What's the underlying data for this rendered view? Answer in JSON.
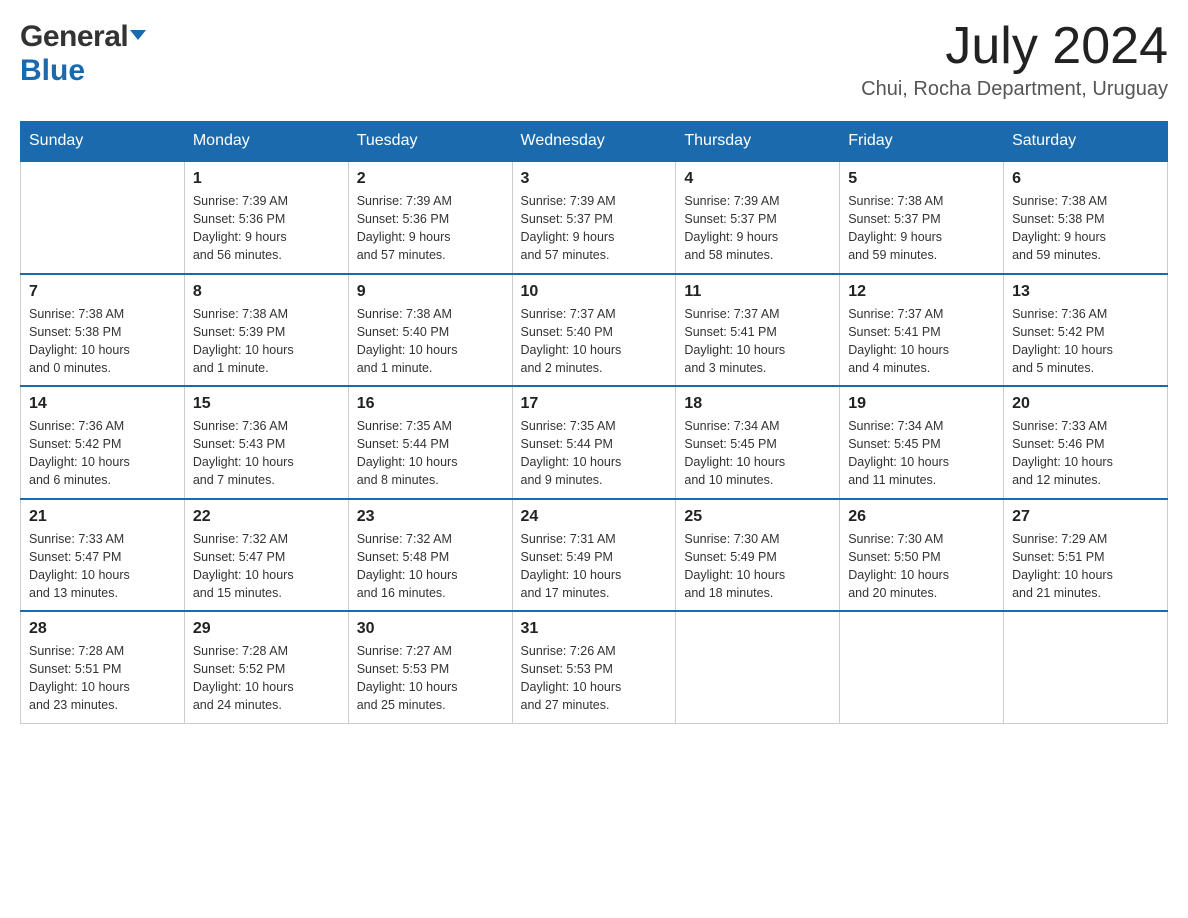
{
  "header": {
    "logo_general": "General",
    "logo_blue": "Blue",
    "month_year": "July 2024",
    "location": "Chui, Rocha Department, Uruguay"
  },
  "days_of_week": [
    "Sunday",
    "Monday",
    "Tuesday",
    "Wednesday",
    "Thursday",
    "Friday",
    "Saturday"
  ],
  "weeks": [
    [
      {
        "day": "",
        "info": ""
      },
      {
        "day": "1",
        "info": "Sunrise: 7:39 AM\nSunset: 5:36 PM\nDaylight: 9 hours\nand 56 minutes."
      },
      {
        "day": "2",
        "info": "Sunrise: 7:39 AM\nSunset: 5:36 PM\nDaylight: 9 hours\nand 57 minutes."
      },
      {
        "day": "3",
        "info": "Sunrise: 7:39 AM\nSunset: 5:37 PM\nDaylight: 9 hours\nand 57 minutes."
      },
      {
        "day": "4",
        "info": "Sunrise: 7:39 AM\nSunset: 5:37 PM\nDaylight: 9 hours\nand 58 minutes."
      },
      {
        "day": "5",
        "info": "Sunrise: 7:38 AM\nSunset: 5:37 PM\nDaylight: 9 hours\nand 59 minutes."
      },
      {
        "day": "6",
        "info": "Sunrise: 7:38 AM\nSunset: 5:38 PM\nDaylight: 9 hours\nand 59 minutes."
      }
    ],
    [
      {
        "day": "7",
        "info": "Sunrise: 7:38 AM\nSunset: 5:38 PM\nDaylight: 10 hours\nand 0 minutes."
      },
      {
        "day": "8",
        "info": "Sunrise: 7:38 AM\nSunset: 5:39 PM\nDaylight: 10 hours\nand 1 minute."
      },
      {
        "day": "9",
        "info": "Sunrise: 7:38 AM\nSunset: 5:40 PM\nDaylight: 10 hours\nand 1 minute."
      },
      {
        "day": "10",
        "info": "Sunrise: 7:37 AM\nSunset: 5:40 PM\nDaylight: 10 hours\nand 2 minutes."
      },
      {
        "day": "11",
        "info": "Sunrise: 7:37 AM\nSunset: 5:41 PM\nDaylight: 10 hours\nand 3 minutes."
      },
      {
        "day": "12",
        "info": "Sunrise: 7:37 AM\nSunset: 5:41 PM\nDaylight: 10 hours\nand 4 minutes."
      },
      {
        "day": "13",
        "info": "Sunrise: 7:36 AM\nSunset: 5:42 PM\nDaylight: 10 hours\nand 5 minutes."
      }
    ],
    [
      {
        "day": "14",
        "info": "Sunrise: 7:36 AM\nSunset: 5:42 PM\nDaylight: 10 hours\nand 6 minutes."
      },
      {
        "day": "15",
        "info": "Sunrise: 7:36 AM\nSunset: 5:43 PM\nDaylight: 10 hours\nand 7 minutes."
      },
      {
        "day": "16",
        "info": "Sunrise: 7:35 AM\nSunset: 5:44 PM\nDaylight: 10 hours\nand 8 minutes."
      },
      {
        "day": "17",
        "info": "Sunrise: 7:35 AM\nSunset: 5:44 PM\nDaylight: 10 hours\nand 9 minutes."
      },
      {
        "day": "18",
        "info": "Sunrise: 7:34 AM\nSunset: 5:45 PM\nDaylight: 10 hours\nand 10 minutes."
      },
      {
        "day": "19",
        "info": "Sunrise: 7:34 AM\nSunset: 5:45 PM\nDaylight: 10 hours\nand 11 minutes."
      },
      {
        "day": "20",
        "info": "Sunrise: 7:33 AM\nSunset: 5:46 PM\nDaylight: 10 hours\nand 12 minutes."
      }
    ],
    [
      {
        "day": "21",
        "info": "Sunrise: 7:33 AM\nSunset: 5:47 PM\nDaylight: 10 hours\nand 13 minutes."
      },
      {
        "day": "22",
        "info": "Sunrise: 7:32 AM\nSunset: 5:47 PM\nDaylight: 10 hours\nand 15 minutes."
      },
      {
        "day": "23",
        "info": "Sunrise: 7:32 AM\nSunset: 5:48 PM\nDaylight: 10 hours\nand 16 minutes."
      },
      {
        "day": "24",
        "info": "Sunrise: 7:31 AM\nSunset: 5:49 PM\nDaylight: 10 hours\nand 17 minutes."
      },
      {
        "day": "25",
        "info": "Sunrise: 7:30 AM\nSunset: 5:49 PM\nDaylight: 10 hours\nand 18 minutes."
      },
      {
        "day": "26",
        "info": "Sunrise: 7:30 AM\nSunset: 5:50 PM\nDaylight: 10 hours\nand 20 minutes."
      },
      {
        "day": "27",
        "info": "Sunrise: 7:29 AM\nSunset: 5:51 PM\nDaylight: 10 hours\nand 21 minutes."
      }
    ],
    [
      {
        "day": "28",
        "info": "Sunrise: 7:28 AM\nSunset: 5:51 PM\nDaylight: 10 hours\nand 23 minutes."
      },
      {
        "day": "29",
        "info": "Sunrise: 7:28 AM\nSunset: 5:52 PM\nDaylight: 10 hours\nand 24 minutes."
      },
      {
        "day": "30",
        "info": "Sunrise: 7:27 AM\nSunset: 5:53 PM\nDaylight: 10 hours\nand 25 minutes."
      },
      {
        "day": "31",
        "info": "Sunrise: 7:26 AM\nSunset: 5:53 PM\nDaylight: 10 hours\nand 27 minutes."
      },
      {
        "day": "",
        "info": ""
      },
      {
        "day": "",
        "info": ""
      },
      {
        "day": "",
        "info": ""
      }
    ]
  ]
}
